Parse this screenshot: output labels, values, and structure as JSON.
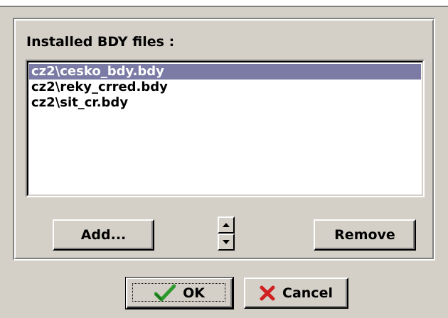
{
  "dialog": {
    "group_title": "Installed BDY files :",
    "files": [
      {
        "label": "cz2\\cesko_bdy.bdy",
        "selected": true
      },
      {
        "label": "cz2\\reky_crred.bdy",
        "selected": false
      },
      {
        "label": "cz2\\sit_cr.bdy",
        "selected": false
      }
    ],
    "add_label": "Add...",
    "remove_label": "Remove",
    "ok_label": "OK",
    "cancel_label": "Cancel",
    "selection_color": "#7b7ba5",
    "ok_icon": "checkmark-icon",
    "cancel_icon": "x-icon",
    "ok_icon_color": "#2e9a2e",
    "cancel_icon_color": "#d02020"
  }
}
